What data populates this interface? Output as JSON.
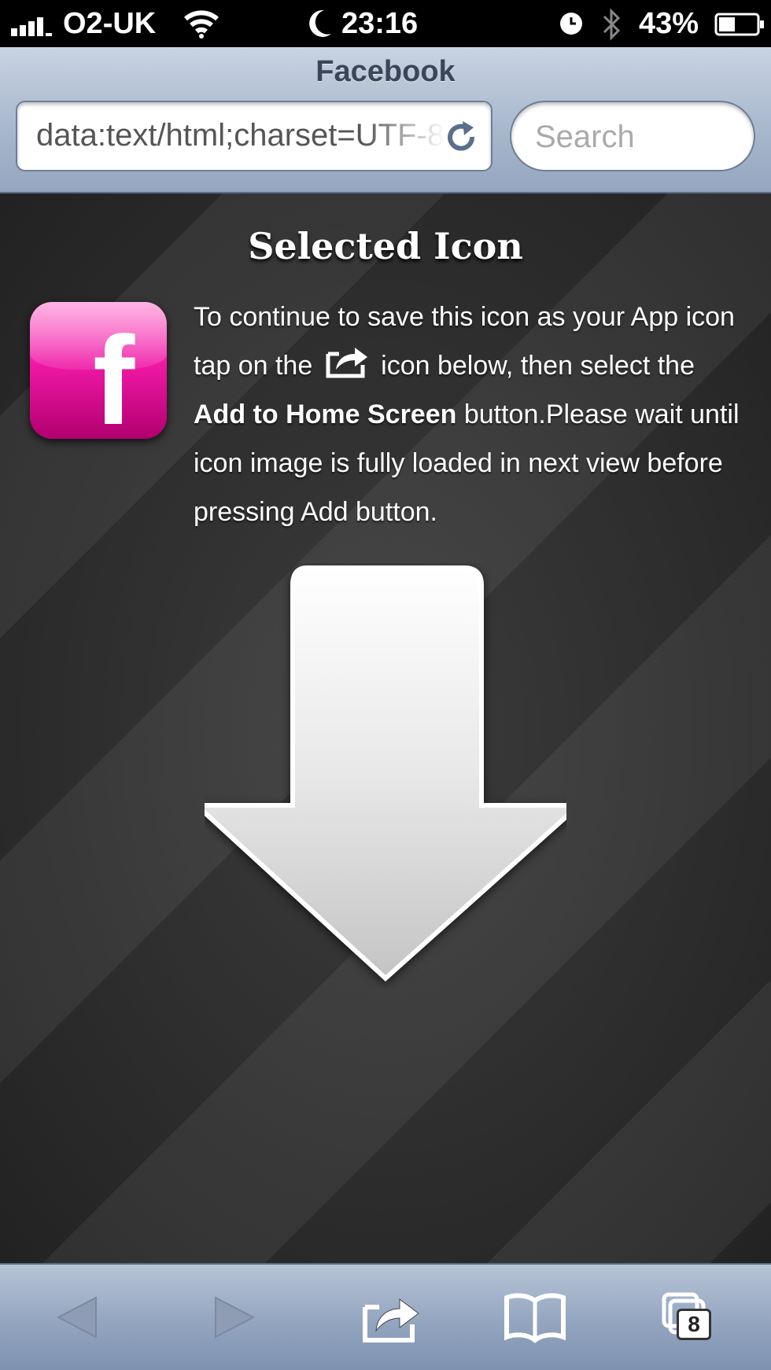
{
  "status_bar": {
    "carrier": "O2-UK",
    "time": "23:16",
    "battery_percent": "43%",
    "battery_level": 0.43,
    "signal_bars": 4,
    "icons": [
      "signal-icon",
      "wifi-icon",
      "moon-icon",
      "alarm-icon",
      "bluetooth-icon",
      "battery-icon"
    ]
  },
  "browser": {
    "page_title": "Facebook",
    "url": "data:text/html;charset=UTF-8",
    "search_placeholder": "Search"
  },
  "content": {
    "heading": "Selected Icon",
    "app_icon": {
      "letter": "f",
      "color_top": "#ff78cf",
      "color_bottom": "#b1006f"
    },
    "instructions": {
      "part1": "To continue to save this icon as your App icon tap on the",
      "part2": "icon below, then select the",
      "bold": "Add to Home Screen",
      "part3": "button.Please wait until icon image is fully loaded in next view before pressing Add button."
    }
  },
  "toolbar": {
    "tabs_count": "8",
    "buttons": [
      "back-icon",
      "forward-icon",
      "share-icon",
      "bookmarks-icon",
      "tabs-icon"
    ]
  },
  "colors": {
    "toolbar": "#93a5bf",
    "content_background": "#2b2b2b",
    "accent_pink": "#f018a6"
  }
}
